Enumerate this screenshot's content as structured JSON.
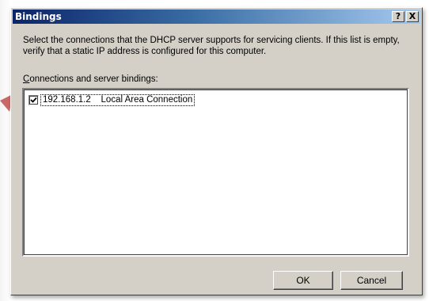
{
  "window": {
    "title": "Bindings",
    "help_label": "?",
    "close_label": "X"
  },
  "description": "Select the connections that the DHCP server supports for servicing clients. If this list is empty, verify that a static IP address is configured for this computer.",
  "list": {
    "label_access_key": "C",
    "label_rest": "onnections and server bindings:",
    "items": [
      {
        "checked": true,
        "text": "192.168.1.2    Local Area Connection"
      }
    ]
  },
  "buttons": {
    "ok_label": "OK",
    "cancel_label": "Cancel"
  },
  "colors": {
    "pointer_arrow": "#c0504d",
    "titlebar_start": "#0a246a",
    "titlebar_end": "#a6caf0",
    "dialog_face": "#d4d0c8"
  }
}
